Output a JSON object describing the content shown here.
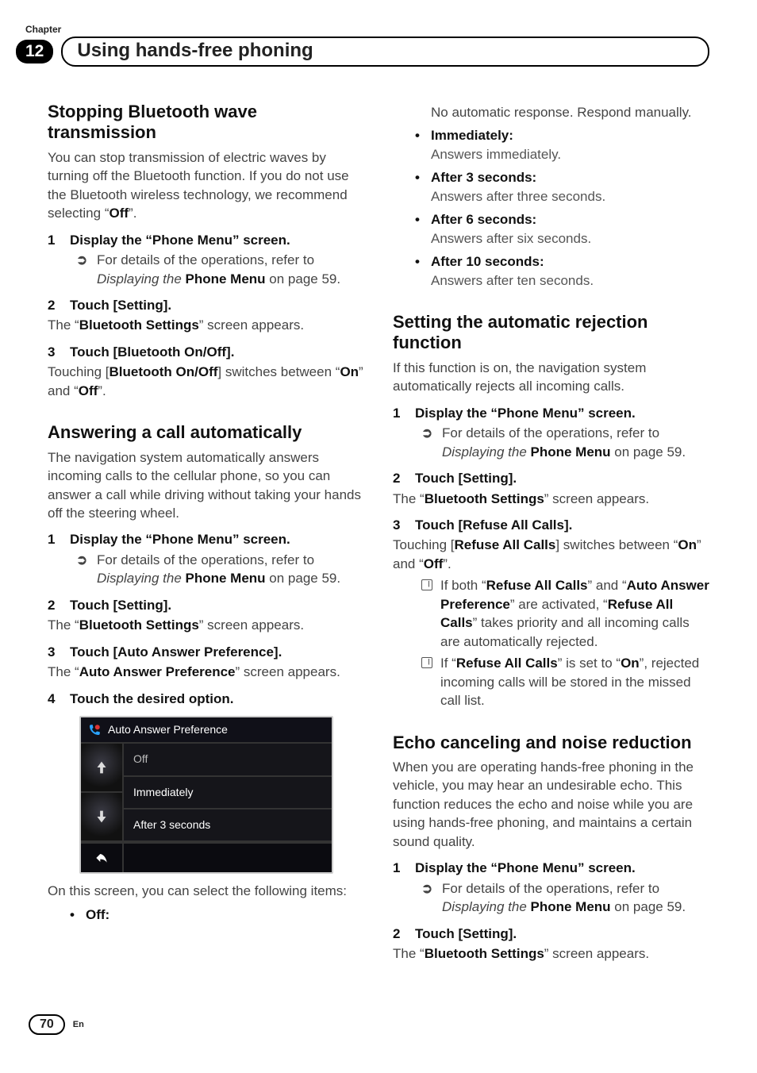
{
  "chapter": {
    "label": "Chapter",
    "number": "12",
    "title": "Using hands-free phoning"
  },
  "left": {
    "s1": {
      "heading": "Stopping Bluetooth wave transmission",
      "intro_a": "You can stop transmission of electric waves by turning off the Bluetooth function. If you do not use the Bluetooth wireless technology, we recommend selecting “",
      "intro_b_bold": "Off",
      "intro_c": "”.",
      "step1": "Display the “Phone Menu” screen.",
      "step1_ref_a": "For details of the operations, refer to ",
      "step1_ref_ital": "Displaying the ",
      "step1_ref_bold": "Phone Menu",
      "step1_ref_tail": " on page 59.",
      "step2": "Touch [Setting].",
      "step2_body_a": "The “",
      "step2_body_b": "Bluetooth Settings",
      "step2_body_c": "” screen appears.",
      "step3": "Touch [Bluetooth On/Off].",
      "step3_body_a": "Touching [",
      "step3_body_b": "Bluetooth On/Off",
      "step3_body_c": "] switches between “",
      "step3_body_d": "On",
      "step3_body_e": "” and “",
      "step3_body_f": "Off",
      "step3_body_g": "”."
    },
    "s2": {
      "heading": "Answering a call automatically",
      "intro": "The navigation system automatically answers incoming calls to the cellular phone, so you can answer a call while driving without taking your hands off the steering wheel.",
      "step1": "Display the “Phone Menu” screen.",
      "step1_ref_a": "For details of the operations, refer to ",
      "step1_ref_ital": "Displaying the ",
      "step1_ref_bold": "Phone Menu",
      "step1_ref_tail": " on page 59.",
      "step2": "Touch [Setting].",
      "step2_body_a": "The “",
      "step2_body_b": "Bluetooth Settings",
      "step2_body_c": "” screen appears.",
      "step3": "Touch [Auto Answer Preference].",
      "step3_body_a": "The “",
      "step3_body_b": "Auto Answer Preference",
      "step3_body_c": "” screen appears.",
      "step4": "Touch the desired option.",
      "ss": {
        "title": "Auto Answer Preference",
        "opt1": "Off",
        "opt2": "Immediately",
        "opt3": "After 3 seconds"
      },
      "after_ss": "On this screen, you can select the following items:",
      "off_label": "Off",
      "off_colon": ":"
    }
  },
  "right": {
    "top": {
      "no_auto": "No automatic response. Respond manually.",
      "imm_head": "Immediately",
      "imm_body": "Answers immediately.",
      "a3_head": "After 3 seconds",
      "a3_body": "Answers after three seconds.",
      "a6_head": "After 6 seconds",
      "a6_body": "Answers after six seconds.",
      "a10_head": "After 10 seconds",
      "a10_body": "Answers after ten seconds."
    },
    "s3": {
      "heading": "Setting the automatic rejection function",
      "intro": "If this function is on, the navigation system automatically rejects all incoming calls.",
      "step1": "Display the “Phone Menu” screen.",
      "step1_ref_a": "For details of the operations, refer to ",
      "step1_ref_ital": "Displaying the ",
      "step1_ref_bold": "Phone Menu",
      "step1_ref_tail": " on page 59.",
      "step2": "Touch [Setting].",
      "step2_body_a": "The “",
      "step2_body_b": "Bluetooth Settings",
      "step2_body_c": "” screen appears.",
      "step3": "Touch [Refuse All Calls].",
      "step3_body_a": "Touching [",
      "step3_body_b": "Refuse All Calls",
      "step3_body_c": "] switches between “",
      "step3_body_d": "On",
      "step3_body_e": "” and “",
      "step3_body_f": "Off",
      "step3_body_g": "”.",
      "note1_a": "If both “",
      "note1_b": "Refuse All Calls",
      "note1_c": "” and “",
      "note1_d": "Auto Answer Preference",
      "note1_e": "” are activated, “",
      "note1_f": "Refuse All Calls",
      "note1_g": "” takes priority and all incoming calls are automatically rejected.",
      "note2_a": "If “",
      "note2_b": "Refuse All Calls",
      "note2_c": "” is set to “",
      "note2_d": "On",
      "note2_e": "”, rejected incoming calls will be stored in the missed call list."
    },
    "s4": {
      "heading": "Echo canceling and noise reduction",
      "intro": "When you are operating hands-free phoning in the vehicle, you may hear an undesirable echo. This function reduces the echo and noise while you are using hands-free phoning, and maintains a certain sound quality.",
      "step1": "Display the “Phone Menu” screen.",
      "step1_ref_a": "For details of the operations, refer to ",
      "step1_ref_ital": "Displaying the ",
      "step1_ref_bold": "Phone Menu",
      "step1_ref_tail": " on page 59.",
      "step2": "Touch [Setting].",
      "step2_body_a": "The “",
      "step2_body_b": "Bluetooth Settings",
      "step2_body_c": "” screen appears."
    }
  },
  "footer": {
    "page": "70",
    "lang": "En"
  }
}
